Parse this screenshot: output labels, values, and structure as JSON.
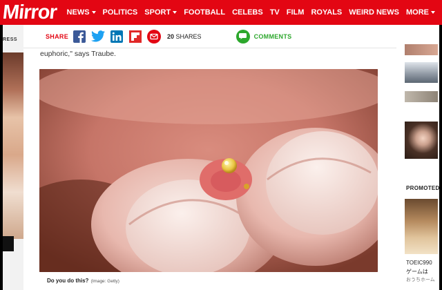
{
  "header": {
    "logo": "Mirror",
    "nav": [
      {
        "label": "NEWS",
        "dropdown": true
      },
      {
        "label": "POLITICS",
        "dropdown": false
      },
      {
        "label": "SPORT",
        "dropdown": true
      },
      {
        "label": "FOOTBALL",
        "dropdown": false
      },
      {
        "label": "CELEBS",
        "dropdown": false
      },
      {
        "label": "TV",
        "dropdown": false
      },
      {
        "label": "FILM",
        "dropdown": false
      },
      {
        "label": "ROYALS",
        "dropdown": false
      },
      {
        "label": "WEIRD NEWS",
        "dropdown": false
      },
      {
        "label": "MORE",
        "dropdown": true
      }
    ]
  },
  "left_ad": {
    "label": "RESS"
  },
  "share": {
    "label": "SHARE",
    "count": "20",
    "count_suffix": "SHARES",
    "comments": "COMMENTS"
  },
  "article": {
    "text": "euphoric,\" says Traube.",
    "caption": "Do you do this?",
    "credit": "(Image: Getty)"
  },
  "right": {
    "promoted": "PROMOTED",
    "promo_line1": "TOEIC990",
    "promo_line2": "ゲームは",
    "promo_line3": "おうちホーム"
  },
  "colors": {
    "brand": "#e30613",
    "facebook": "#3b5998",
    "twitter": "#1da1f2",
    "linkedin": "#0077b5",
    "comments": "#2ca72c"
  }
}
